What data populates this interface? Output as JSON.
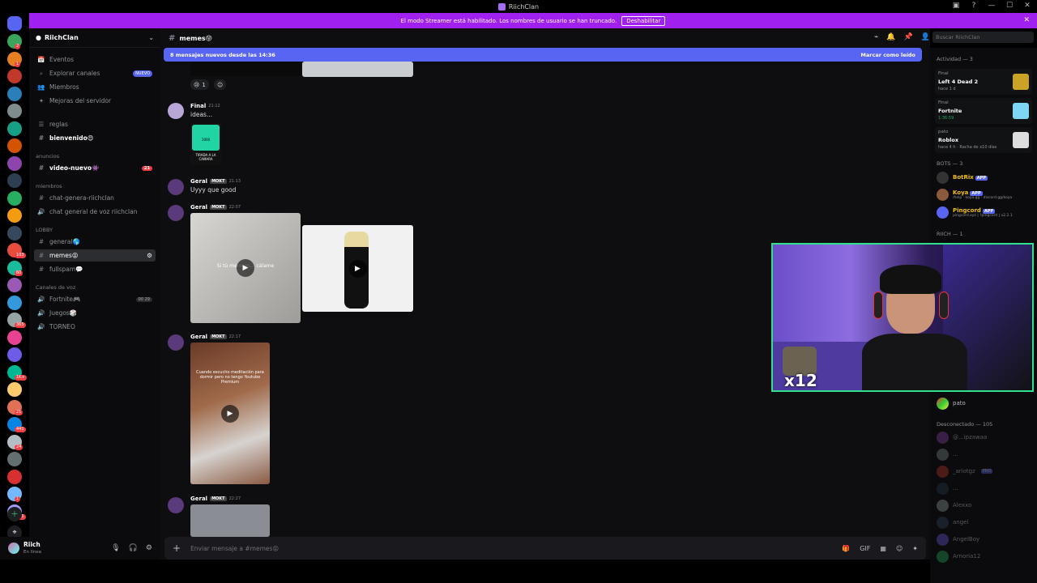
{
  "window": {
    "title": "RiichClan",
    "controls": [
      "▣",
      "?",
      "—",
      "☐",
      "✕"
    ]
  },
  "streamer_banner": {
    "text": "El modo Streamer está habilitado. Los nombres de usuario se han truncado.",
    "button": "Deshabilitar",
    "close": "✕"
  },
  "guilds": {
    "badges": [
      "2",
      "1",
      "",
      "",
      "",
      "",
      "",
      "",
      "",
      "",
      "",
      "",
      "103",
      "60",
      "",
      "",
      "365",
      "",
      "",
      "1K+",
      "",
      "21",
      "441",
      "24",
      "",
      "",
      "1",
      "261",
      "",
      "507",
      "",
      "347",
      "",
      ""
    ]
  },
  "sidebar": {
    "server_name": "RiichClan",
    "items": [
      {
        "icon": "📅",
        "label": "Eventos"
      },
      {
        "icon": "⌕",
        "label": "Explorar canales",
        "badge": "NUEVO"
      },
      {
        "icon": "👥",
        "label": "Miembros"
      },
      {
        "icon": "✦",
        "label": "Mejoras del servidor"
      }
    ],
    "channels_top": [
      {
        "label": "reglas"
      },
      {
        "label": "bienvenido😍"
      }
    ],
    "cat_anuncios": "anuncios",
    "video_nuevo": {
      "label": "video-nuevo👾",
      "badge": "21"
    },
    "cat_miembros": "miembros",
    "chat_genera": "chat-genera-riichclan",
    "chat_voz": "chat general de voz riichclan",
    "cat_lobby": "LOBBY",
    "general": "general🌎",
    "memes": "memes😝",
    "fullspam": "fullspam💬",
    "cat_voz": "Canales de voz",
    "fortnite": {
      "label": "Fortnite🎮",
      "counts": "00 29"
    },
    "juegos": "Juegos🎲",
    "torneo": "TORNEO"
  },
  "user": {
    "name": "Riich",
    "status": "En línea",
    "icons": [
      "🎙",
      "🎧",
      "⚙"
    ]
  },
  "channel": {
    "name": "memes😝",
    "header_icons": [
      "⌁",
      "🔔",
      "📌",
      "👤"
    ],
    "new_messages": "8 mensajes nuevos desde las 14:36",
    "mark_read": "Marcar como leído"
  },
  "messages": [
    {
      "author": "Final",
      "time": "21:12",
      "text": "ideas..."
    },
    {
      "author": "Geral",
      "tag": "MOKT",
      "time": "21:13",
      "text": "Uyyy que good"
    },
    {
      "author": "Geral",
      "tag": "MOKT",
      "time": "22:07"
    },
    {
      "author": "Geral",
      "tag": "MOKT",
      "time": "22:17"
    },
    {
      "author": "Geral",
      "tag": "MOKT",
      "time": "22:27"
    }
  ],
  "reaction": {
    "emoji": "😢",
    "count": "1"
  },
  "media": {
    "card_label": "TIRADA A LA CAMARA",
    "card_num": "3000",
    "video1_caption": "Si tú mereces... cálame",
    "video3_caption": "Cuando escucho meditación para dormir pero no tengo Youtube Premium"
  },
  "input": {
    "placeholder": "Enviar mensaje a #memes😝",
    "icons": [
      "🎁",
      "GIF",
      "▦",
      "☺",
      "✦"
    ]
  },
  "search": {
    "placeholder": "Buscar RiichClan"
  },
  "members": {
    "activity_head": "Actividad — 3",
    "activities": [
      {
        "who": "Final",
        "game": "Left 4 Dead 2",
        "sub": "hace 1 d",
        "color": "#c9a227"
      },
      {
        "who": "Final",
        "game": "Fortnite",
        "sub": "1:36:59",
        "color": "#7fd6f2"
      },
      {
        "who": "pato",
        "game": "Roblox",
        "sub": "hace 4 h · Racha de x10 días",
        "color": "#dddddd"
      }
    ],
    "bots_head": "BOTS — 3",
    "bots": [
      {
        "name": "BotRix",
        "app": "APP",
        "sub": "",
        "color": "#f0c000"
      },
      {
        "name": "Koya",
        "app": "APP",
        "sub": "/help · koya.gg · discord.gg/koya",
        "color": "#f0c000"
      },
      {
        "name": "Pingcord",
        "app": "APP",
        "sub": "pingcord.xyz | ?pingcord | v2.2.1",
        "color": "#f0c000"
      }
    ],
    "riich_head": "RIICH — 1",
    "pato": "pato",
    "offline_head": "Desconectado — 105",
    "offline": [
      "@...ipzawaa",
      "...",
      "_ariotgz",
      "...",
      "Alexxo",
      "angel",
      "AngelBoy",
      "Arnoria12"
    ],
    "offline_tag": "PRO"
  },
  "webcam": {
    "overlay_text": "x12"
  }
}
